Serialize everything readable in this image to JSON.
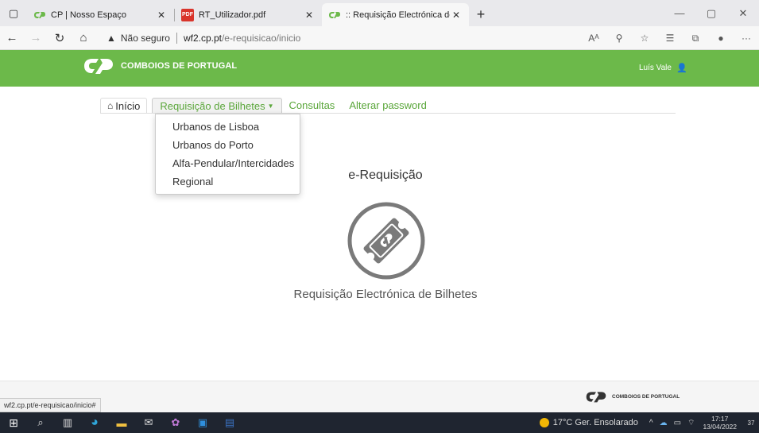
{
  "browser": {
    "tabs": [
      {
        "title": "CP | Nosso Espaço",
        "favicon": "cp-logo-icon"
      },
      {
        "title": "RT_Utilizador.pdf",
        "favicon": "pdf-icon"
      },
      {
        "title": ":: Requisição Electrónica de Trans",
        "favicon": "cp-logo-icon"
      }
    ],
    "address": {
      "security_label": "Não seguro",
      "host": "wf2.cp.pt",
      "path": "/e-requisicao/inicio"
    },
    "status_url": "wf2.cp.pt/e-requisicao/inicio#"
  },
  "site": {
    "brand": "COMBOIOS DE PORTUGAL",
    "user_name": "Luís Vale",
    "brand_color": "#6cb94a",
    "nav": {
      "home": "Início",
      "requisicao": "Requisição de Bilhetes",
      "consultas": "Consultas",
      "alterar_password": "Alterar password"
    },
    "dropdown": [
      "Urbanos de Lisboa",
      "Urbanos do Porto",
      "Alfa-Pendular/Intercidades",
      "Regional"
    ],
    "title": "e-Requisição",
    "subtitle": "Requisição Electrónica de Bilhetes",
    "footer_brand": "COMBOIOS DE PORTUGAL"
  },
  "taskbar": {
    "weather": "17°C  Ger. Ensolarado",
    "time": "17:17",
    "date": "13/04/2022",
    "notifications": "37"
  }
}
